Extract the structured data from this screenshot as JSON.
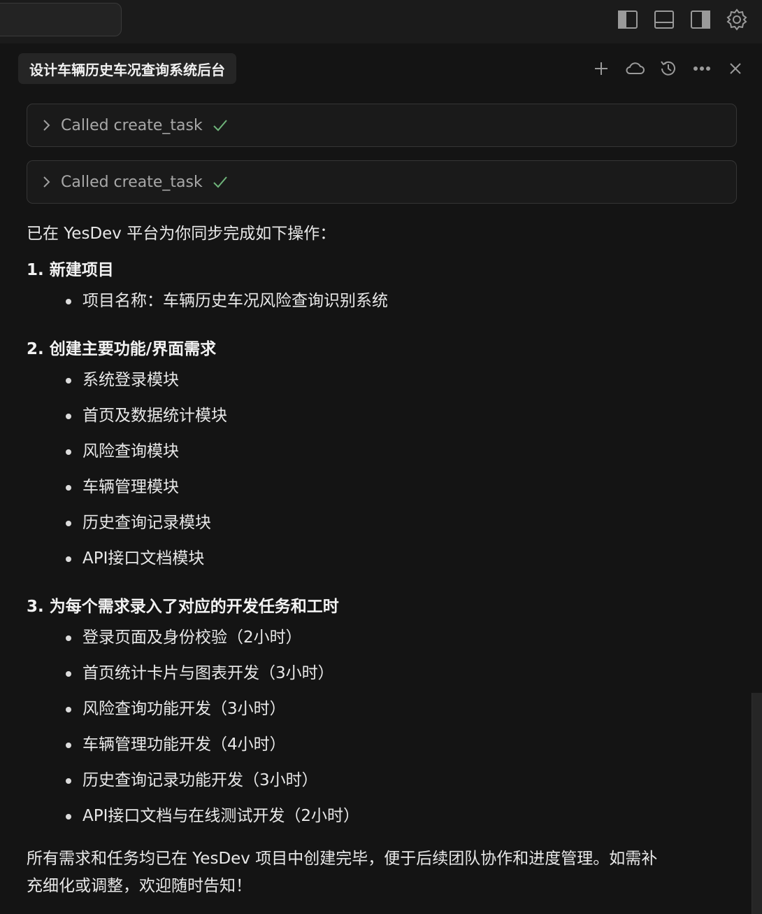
{
  "tab": {
    "title": "设计车辆历史车况查询系统后台"
  },
  "tools": [
    {
      "label": "Called create_task"
    },
    {
      "label": "Called create_task"
    }
  ],
  "message": {
    "intro": "已在 YesDev 平台为你同步完成如下操作：",
    "sections": [
      {
        "heading": "1. 新建项目",
        "items": [
          "项目名称：车辆历史车况风险查询识别系统"
        ]
      },
      {
        "heading": "2. 创建主要功能/界面需求",
        "items": [
          "系统登录模块",
          "首页及数据统计模块",
          "风险查询模块",
          "车辆管理模块",
          "历史查询记录模块",
          "API接口文档模块"
        ]
      },
      {
        "heading": "3. 为每个需求录入了对应的开发任务和工时",
        "items": [
          "登录页面及身份校验（2小时）",
          "首页统计卡片与图表开发（3小时）",
          "风险查询功能开发（3小时）",
          "车辆管理功能开发（4小时）",
          "历史查询记录功能开发（3小时）",
          "API接口文档与在线测试开发（2小时）"
        ]
      }
    ],
    "summary_line1": "所有需求和任务均已在 YesDev 项目中创建完毕，便于后续团队协作和进度管理。如需补",
    "summary_line2": "充细化或调整，欢迎随时告知！"
  },
  "icons": {
    "top": [
      "toggle-left-sidebar-icon",
      "toggle-bottom-panel-icon",
      "toggle-right-sidebar-icon",
      "gear-icon"
    ],
    "tab": [
      "plus-icon",
      "cloud-icon",
      "history-icon",
      "more-icon",
      "close-icon"
    ]
  },
  "colors": {
    "background": "#141414",
    "check": "#6fb47a",
    "text": "#e6e6e6"
  }
}
